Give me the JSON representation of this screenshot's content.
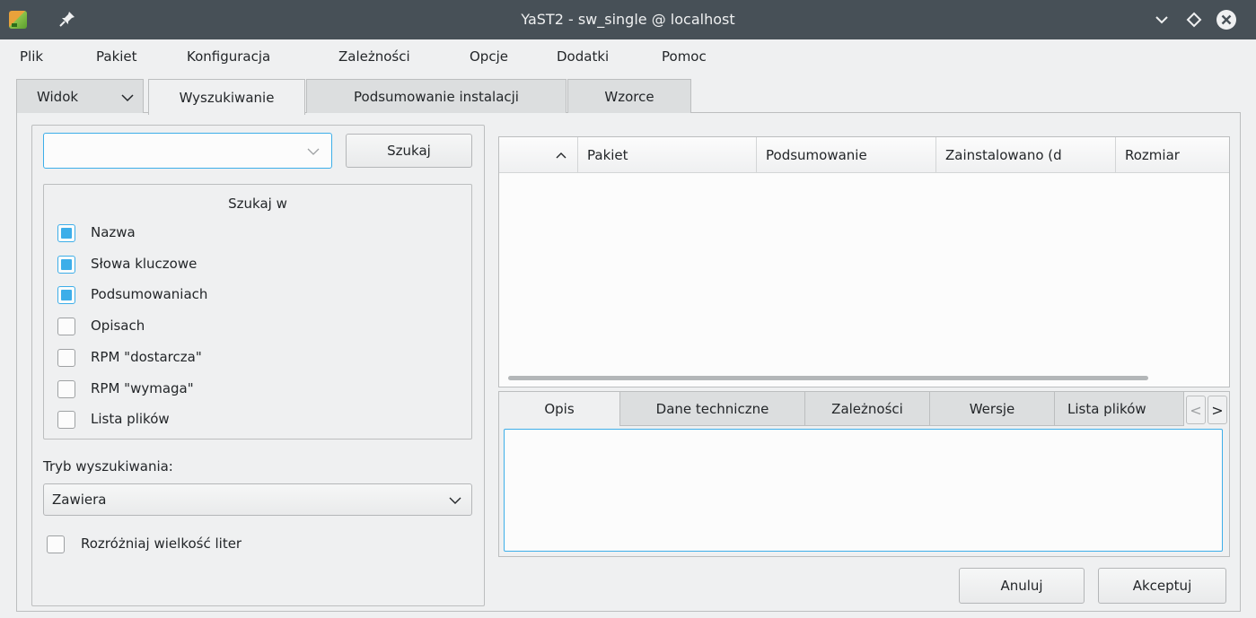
{
  "window": {
    "title": "YaST2 - sw_single @ localhost",
    "icons": [
      "yast-app-icon",
      "pin-icon",
      "minimize-chevron-icon",
      "maximize-diamond-icon",
      "close-icon"
    ]
  },
  "menubar": {
    "items": [
      "Plik",
      "Pakiet",
      "Konfiguracja",
      "Zależności",
      "Opcje",
      "Dodatki",
      "Pomoc"
    ]
  },
  "tabs": {
    "view_label": "Widok",
    "items": [
      "Wyszukiwanie",
      "Podsumowanie instalacji",
      "Wzorce"
    ],
    "active": "Wyszukiwanie"
  },
  "search": {
    "input_value": "",
    "button_label": "Szukaj",
    "group_title": "Szukaj w",
    "options": [
      {
        "label": "Nazwa",
        "checked": true
      },
      {
        "label": "Słowa kluczowe",
        "checked": true
      },
      {
        "label": "Podsumowaniach",
        "checked": true
      },
      {
        "label": "Opisach",
        "checked": false
      },
      {
        "label": "RPM \"dostarcza\"",
        "checked": false
      },
      {
        "label": "RPM \"wymaga\"",
        "checked": false
      },
      {
        "label": "Lista plików",
        "checked": false
      }
    ],
    "mode_label": "Tryb wyszukiwania:",
    "mode_value": "Zawiera",
    "case_sensitive_label": "Rozróżniaj wielkość liter",
    "case_sensitive_checked": false
  },
  "package_table": {
    "columns": [
      "Pakiet",
      "Podsumowanie",
      "Zainstalowano (d",
      "Rozmiar"
    ],
    "rows": []
  },
  "details": {
    "tabs": [
      "Opis",
      "Dane techniczne",
      "Zależności",
      "Wersje",
      "Lista plików"
    ],
    "active": "Opis",
    "description": ""
  },
  "buttons": {
    "cancel": "Anuluj",
    "accept": "Akceptuj"
  },
  "colors": {
    "titlebar": "#475057",
    "accent": "#3daee9",
    "background": "#eff0f1"
  }
}
